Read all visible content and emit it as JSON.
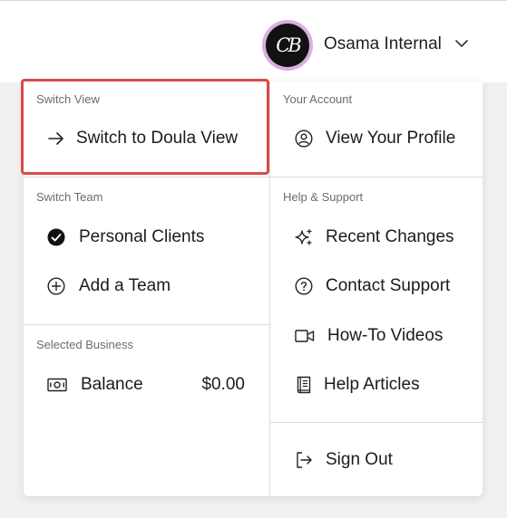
{
  "header": {
    "avatar_initials": "CB",
    "user_name": "Osama Internal",
    "menu_icon": "chevron-down-icon"
  },
  "left": {
    "switch_view": {
      "label": "Switch View",
      "item": {
        "label": "Switch to Doula View",
        "icon": "arrow-right-icon"
      }
    },
    "switch_team": {
      "label": "Switch Team",
      "items": [
        {
          "label": "Personal Clients",
          "icon": "check-circle-icon",
          "selected": true
        },
        {
          "label": "Add a Team",
          "icon": "plus-circle-icon"
        }
      ]
    },
    "selected_business": {
      "label": "Selected Business",
      "balance_label": "Balance",
      "balance_value": "$0.00",
      "icon": "cash-icon"
    }
  },
  "right": {
    "account": {
      "label": "Your Account",
      "item": {
        "label": "View Your Profile",
        "icon": "user-circle-icon"
      }
    },
    "help": {
      "label": "Help & Support",
      "items": [
        {
          "label": "Recent Changes",
          "icon": "sparkles-icon"
        },
        {
          "label": "Contact Support",
          "icon": "question-circle-icon"
        },
        {
          "label": "How-To Videos",
          "icon": "video-camera-icon"
        },
        {
          "label": "Help Articles",
          "icon": "book-icon"
        }
      ]
    },
    "sign_out": {
      "label": "Sign Out",
      "icon": "sign-out-icon"
    }
  },
  "colors": {
    "highlight": "#d94a4a",
    "avatar_ring": "#d8b0df",
    "avatar_bg": "#111111"
  }
}
